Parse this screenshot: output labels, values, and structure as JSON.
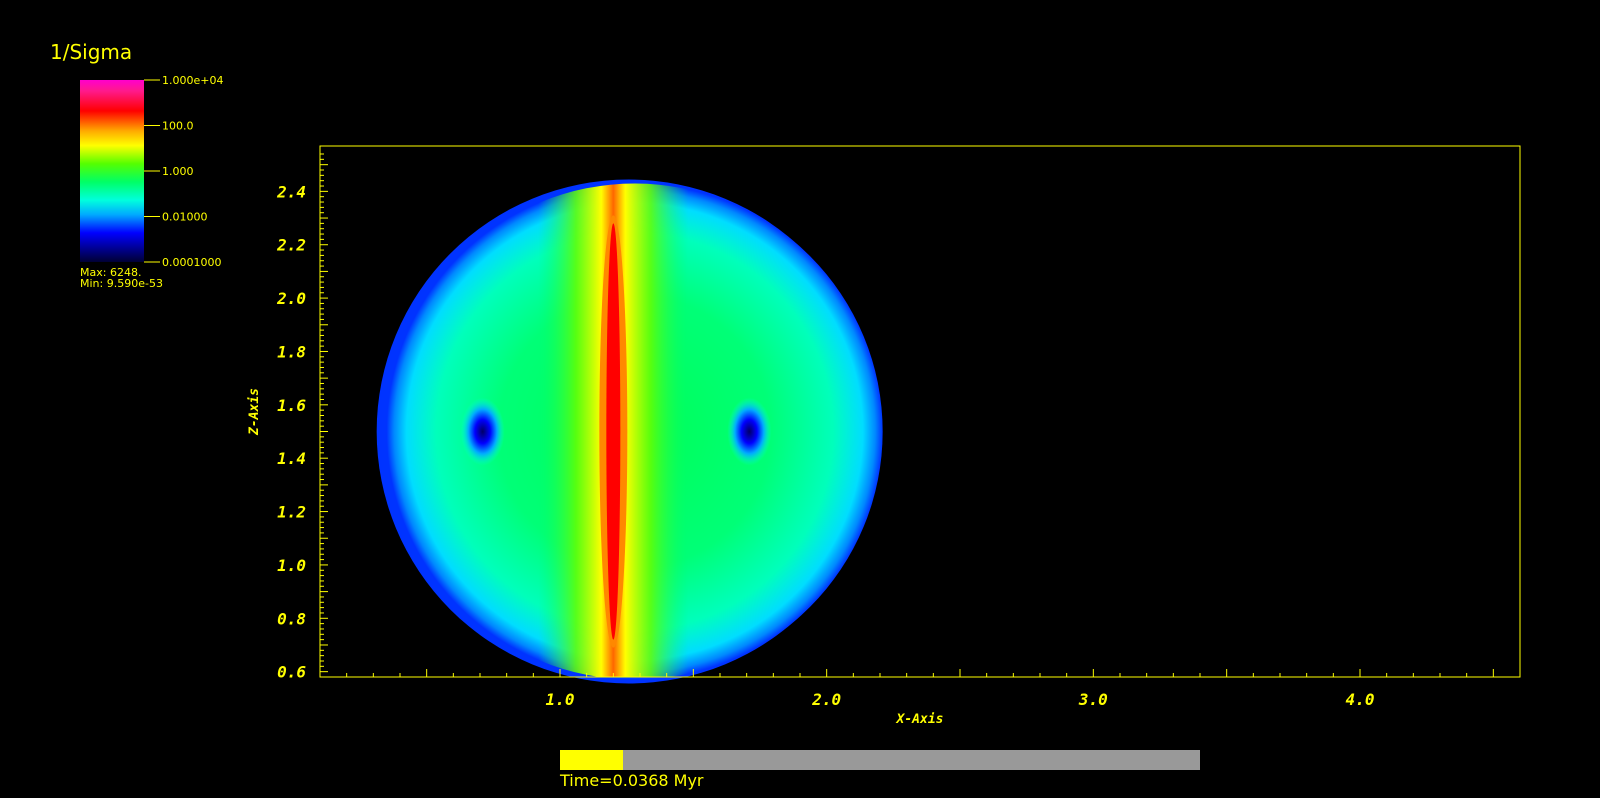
{
  "legend": {
    "title": "1/Sigma",
    "ticks": [
      "1.000e+04",
      "100.0",
      "1.000",
      "0.01000",
      "0.0001000"
    ],
    "max_label": "Max:  6248.",
    "min_label": "Min:  9.590e-53"
  },
  "time": {
    "label": "Time=0.0368 Myr",
    "progress": 0.098
  },
  "colors": {
    "axis": "#ffff00",
    "background": "#000000",
    "progress_track": "#999999",
    "progress_fill": "#ffff00"
  },
  "chart_data": {
    "type": "heatmap",
    "title": "",
    "xlabel": "X-Axis",
    "ylabel": "Z-Axis",
    "xlim": [
      0.1,
      4.6
    ],
    "ylim": [
      0.58,
      2.57
    ],
    "xticks": [
      1.0,
      2.0,
      3.0,
      4.0
    ],
    "xtick_labels": [
      "1.0",
      "2.0",
      "3.0",
      "4.0"
    ],
    "yticks": [
      0.6,
      0.8,
      1.0,
      1.2,
      1.4,
      1.6,
      1.8,
      2.0,
      2.2,
      2.4
    ],
    "ytick_labels": [
      "0.6",
      "0.8",
      "1.0",
      "1.2",
      "1.4",
      "1.6",
      "1.8",
      "2.0",
      "2.2",
      "2.4"
    ],
    "colorscale": "log",
    "crange": [
      0.0001,
      10000
    ],
    "grid": false,
    "field": {
      "name": "1/Sigma",
      "circle_center": [
        1.28,
        1.5
      ],
      "circle_radius": 0.93,
      "ridge_x": 1.2,
      "ridge_z_range": [
        0.72,
        2.28
      ],
      "holes": [
        [
          0.71,
          1.5
        ],
        [
          1.71,
          1.5
        ]
      ]
    }
  }
}
